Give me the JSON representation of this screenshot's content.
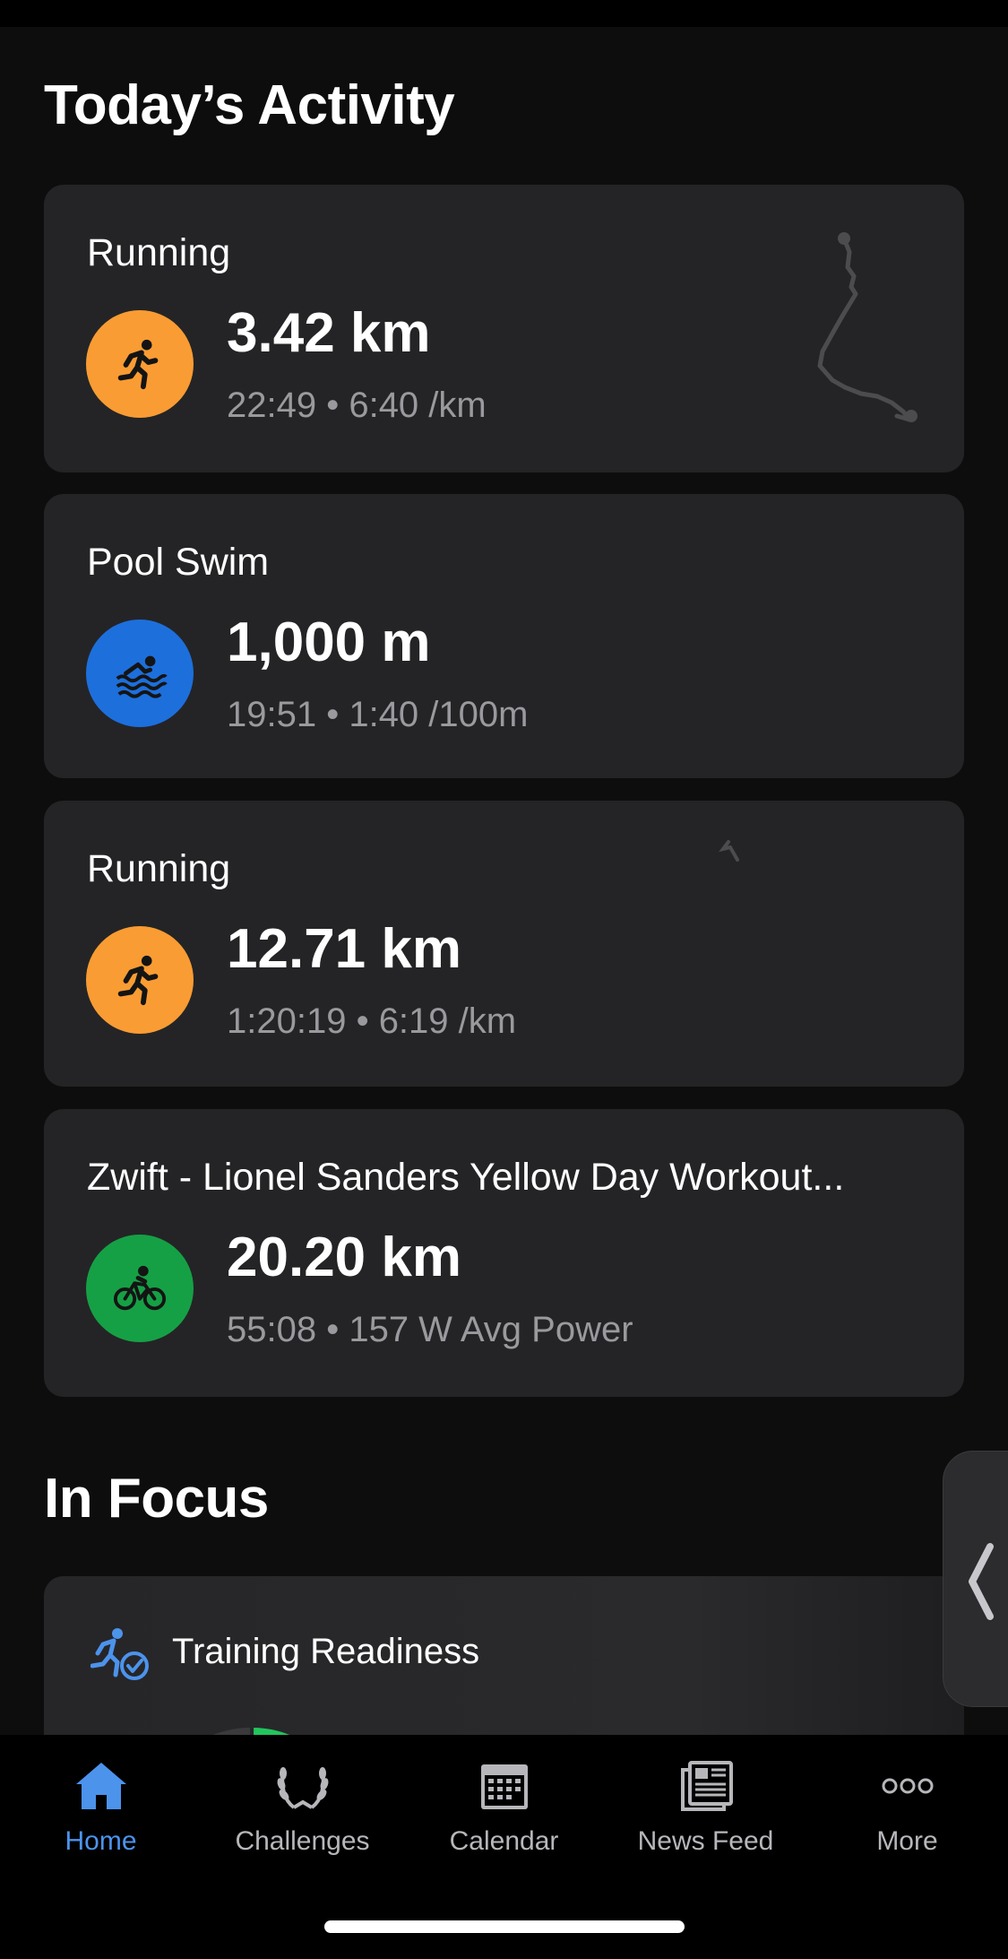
{
  "sections": {
    "todays_activity": "Today’s Activity",
    "in_focus": "In Focus"
  },
  "activities": [
    {
      "title": "Running",
      "metric": "3.42 km",
      "detail": "22:49 • 6:40 /km",
      "icon": "running-icon",
      "color": "#f99c33"
    },
    {
      "title": "Pool Swim",
      "metric": "1,000 m",
      "detail": "19:51 • 1:40 /100m",
      "icon": "swimming-icon",
      "color": "#1d6fdc"
    },
    {
      "title": "Running",
      "metric": "12.71 km",
      "detail": "1:20:19 • 6:19 /km",
      "icon": "running-icon",
      "color": "#f99c33"
    },
    {
      "title": "Zwift - Lionel Sanders  Yellow Day Workout...",
      "metric": "20.20 km",
      "detail": "55:08 • 157 W Avg Power",
      "icon": "cycling-icon",
      "color": "#16a045"
    }
  ],
  "focus": {
    "title": "Training Readiness",
    "icon": "training-readiness-icon"
  },
  "tabbar": {
    "tabs": [
      {
        "label": "Home",
        "icon": "home-icon",
        "active": true
      },
      {
        "label": "Challenges",
        "icon": "laurel-icon",
        "active": false
      },
      {
        "label": "Calendar",
        "icon": "calendar-icon",
        "active": false
      },
      {
        "label": "News Feed",
        "icon": "news-feed-icon",
        "active": false
      },
      {
        "label": "More",
        "icon": "more-icon",
        "active": false
      }
    ]
  },
  "colors": {
    "accent": "#4c93ec",
    "card": "#242426",
    "background": "#0d0d0d",
    "readiness_green": "#22c55e"
  }
}
